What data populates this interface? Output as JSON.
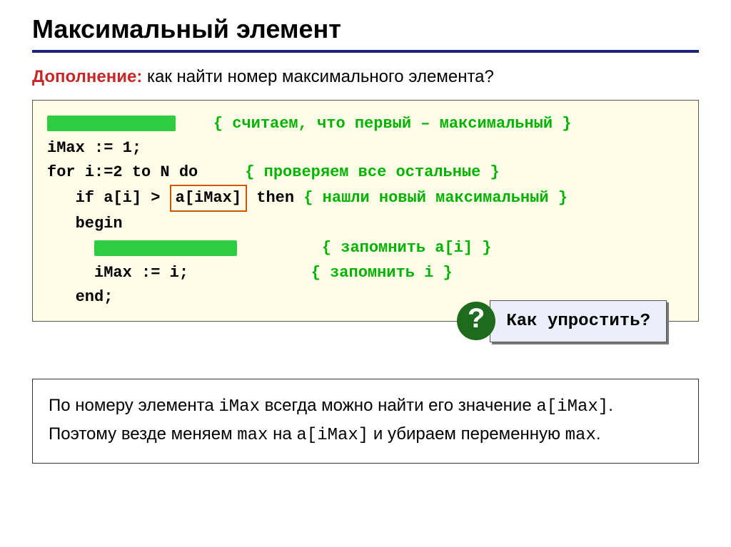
{
  "title": "Максимальный элемент",
  "subtitle": {
    "prefix": "Дополнение:",
    "rest": " как найти номер максимального элемента?"
  },
  "code": {
    "c1": "{ считаем, что первый – максимальный }",
    "l2": "iMax := 1;",
    "l3a": "for i:=2 to N do",
    "c3": "{ проверяем все остальные }",
    "l4a": "   if a[i] > ",
    "l4box": "a[iMax]",
    "l4b": " then ",
    "c4": "{ нашли новый максимальный }",
    "l5": "   begin",
    "c6": "{ запомнить a[i] }",
    "l7": "     iMax := i;",
    "c7": "{ запомнить i }",
    "l8": "   end;"
  },
  "simplify": {
    "q": "?",
    "label": "Как упростить?"
  },
  "explain": {
    "t1": "По номеру элемента ",
    "m1": "iMax",
    "t2": " всегда можно найти его значение ",
    "m2": "a[iMax]",
    "t3": ". Поэтому везде меняем ",
    "m3": "max",
    "t4": " на ",
    "m4": "a[iMax]",
    "t5": " и убираем переменную ",
    "m5": "max",
    "t6": "."
  }
}
